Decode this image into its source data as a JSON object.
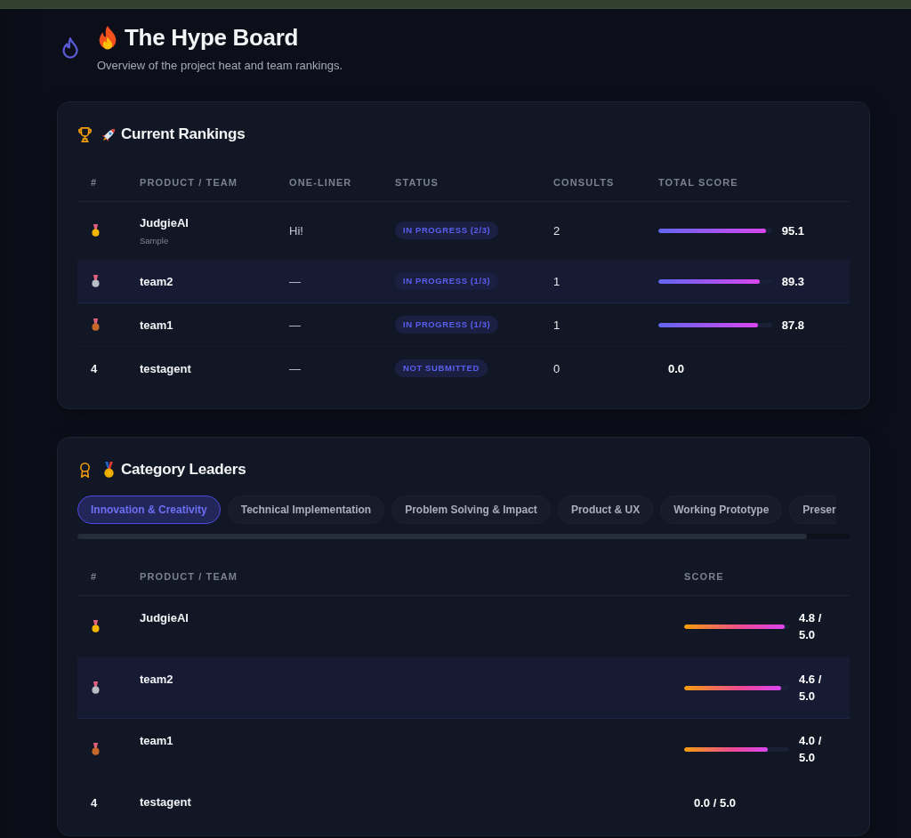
{
  "header": {
    "title": "The Hype Board",
    "subtitle": "Overview of the project heat and team rankings."
  },
  "rankings": {
    "title": "Current Rankings",
    "columns": [
      "#",
      "PRODUCT / TEAM",
      "ONE-LINER",
      "STATUS",
      "CONSULTS",
      "TOTAL SCORE"
    ],
    "rows": [
      {
        "rank": {
          "kind": "medal",
          "color": "#f5b400"
        },
        "name": "JudgieAI",
        "subtitle": "Sample",
        "one_liner": "Hi!",
        "status": "IN PROGRESS (2/3)",
        "consults": "2",
        "level": 0.951,
        "score": "95.1",
        "highlighted": false
      },
      {
        "rank": {
          "kind": "medal",
          "color": "#b9bdc6"
        },
        "name": "team2",
        "one_liner": "—",
        "status": "IN PROGRESS (1/3)",
        "consults": "1",
        "level": 0.893,
        "score": "89.3",
        "highlighted": true
      },
      {
        "rank": {
          "kind": "medal",
          "color": "#c8672a"
        },
        "name": "team1",
        "one_liner": "—",
        "status": "IN PROGRESS (1/3)",
        "consults": "1",
        "level": 0.878,
        "score": "87.8",
        "highlighted": false
      },
      {
        "rank": {
          "kind": "number",
          "text": "4"
        },
        "name": "testagent",
        "one_liner": "—",
        "status": "NOT SUBMITTED",
        "consults": "0",
        "score": "0.0",
        "highlighted": false
      }
    ]
  },
  "category_leaders": {
    "title": "Category Leaders",
    "tabs": [
      {
        "label": "Innovation & Creativity",
        "selected": true
      },
      {
        "label": "Technical Implementation",
        "selected": false
      },
      {
        "label": "Problem Solving & Impact",
        "selected": false
      },
      {
        "label": "Product & UX",
        "selected": false
      },
      {
        "label": "Working Prototype",
        "selected": false
      },
      {
        "label": "Preser",
        "selected": false
      }
    ],
    "columns": [
      "#",
      "PRODUCT / TEAM",
      "SCORE"
    ],
    "rows": [
      {
        "rank": {
          "kind": "medal",
          "color": "#f5b400"
        },
        "name": "JudgieAI",
        "level": 0.96,
        "score": "4.8 / 5.0",
        "highlighted": false
      },
      {
        "rank": {
          "kind": "medal",
          "color": "#b9bdc6"
        },
        "name": "team2",
        "level": 0.92,
        "score": "4.6 / 5.0",
        "highlighted": true
      },
      {
        "rank": {
          "kind": "medal",
          "color": "#c8672a"
        },
        "name": "team1",
        "level": 0.8,
        "score": "4.0 / 5.0",
        "highlighted": false
      },
      {
        "rank": {
          "kind": "number",
          "text": "4"
        },
        "name": "testagent",
        "score": "0.0 / 5.0",
        "highlighted": false
      }
    ]
  }
}
